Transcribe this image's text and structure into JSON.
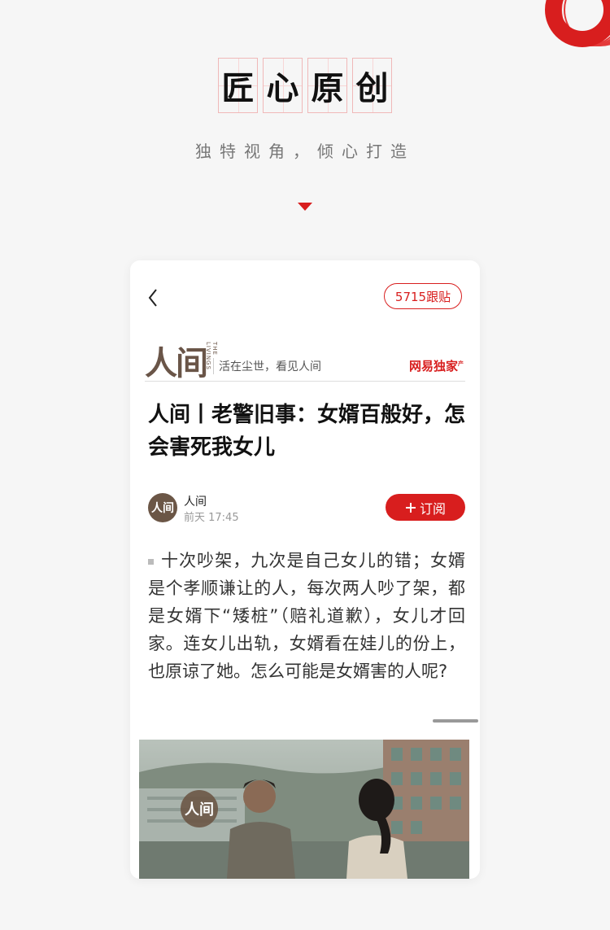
{
  "hero": {
    "title_chars": [
      "匠",
      "心",
      "原",
      "创"
    ],
    "subtitle": "独特视角，倾心打造"
  },
  "article": {
    "back_icon": "chevron-left-icon",
    "comments_label": "5715跟贴",
    "column": {
      "logo": "人间",
      "logo_en": "THE LIVINGS",
      "slogan": "活在尘世，看见人间",
      "exclusive_tag": "网易独家",
      "exclusive_sup": "产"
    },
    "headline": "人间丨老警旧事：女婿百般好，怎会害死我女儿",
    "author": {
      "avatar_text": "人间",
      "name": "人间",
      "time": "前天 17:45"
    },
    "subscribe_label": "订阅",
    "summary": "十次吵架，九次是自己女儿的错；女婿是个孝顺谦让的人，每次两人吵了架，都是女婿下“矮桩”（赔礼道歉），女儿才回家。连女儿出轨，女婿看在娃儿的份上，也原谅了她。怎么可能是女婿害的人呢?",
    "image_watermark": "人间"
  },
  "colors": {
    "accent": "#d81e1e",
    "brand_brown": "#6a5548",
    "background": "#f6f6f6"
  }
}
